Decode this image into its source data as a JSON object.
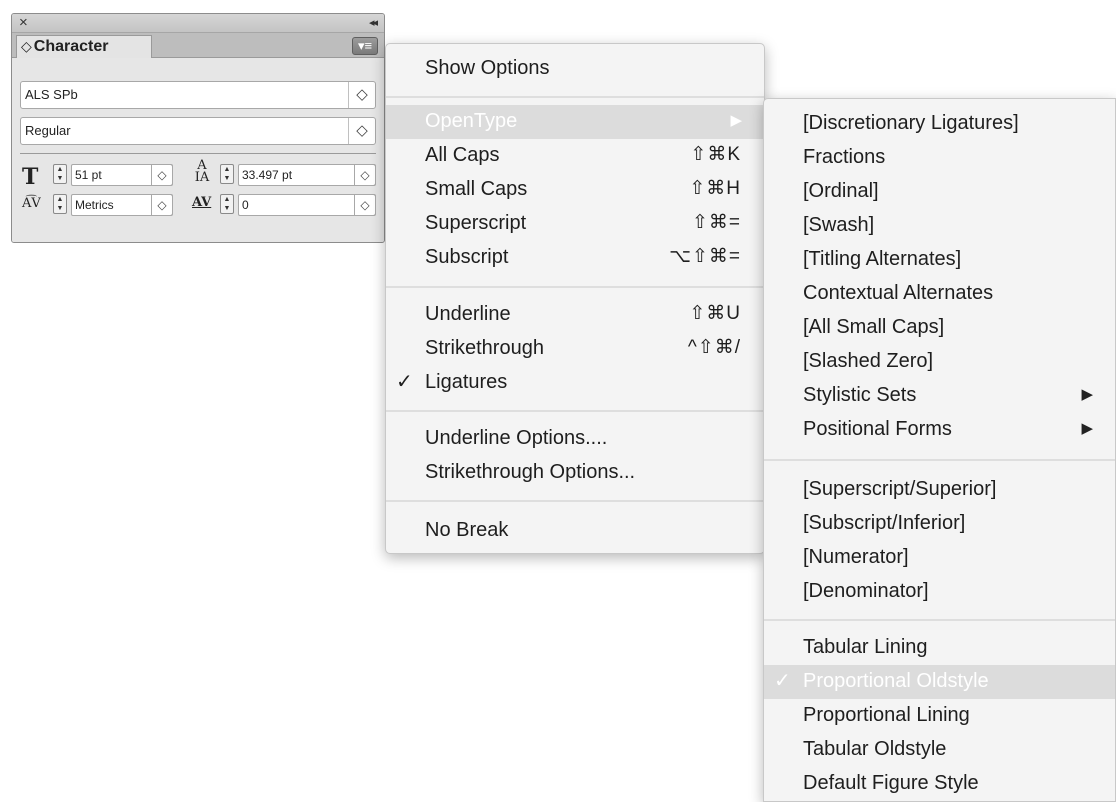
{
  "panel": {
    "close": "×",
    "collapse": "◂◂",
    "title": "Character",
    "tab_arrows": "◇",
    "menu_button": "▾≡",
    "font_family": "ALS SPb",
    "font_style": "Regular",
    "font_size": "51 pt",
    "leading": "33.497 pt",
    "kerning": "Metrics",
    "tracking": "0"
  },
  "main_menu": {
    "show_options": "Show Options",
    "opentype": "OpenType",
    "all_caps": "All Caps",
    "all_caps_sc": "⇧⌘K",
    "small_caps": "Small Caps",
    "small_caps_sc": "⇧⌘H",
    "superscript": "Superscript",
    "superscript_sc": "⇧⌘=",
    "subscript": "Subscript",
    "subscript_sc": "⌥⇧⌘=",
    "underline": "Underline",
    "underline_sc": "⇧⌘U",
    "strikethrough": "Strikethrough",
    "strikethrough_sc": "^⇧⌘/",
    "ligatures": "Ligatures",
    "underline_options": "Underline Options....",
    "strikethrough_options": "Strikethrough Options...",
    "no_break": "No Break"
  },
  "opentype_menu": {
    "discretionary_ligatures": "[Discretionary Ligatures]",
    "fractions": "Fractions",
    "ordinal": "[Ordinal]",
    "swash": "[Swash]",
    "titling_alternates": "[Titling Alternates]",
    "contextual_alternates": "Contextual Alternates",
    "all_small_caps": "[All Small Caps]",
    "slashed_zero": "[Slashed Zero]",
    "stylistic_sets": "Stylistic Sets",
    "positional_forms": "Positional Forms",
    "superscript_superior": "[Superscript/Superior]",
    "subscript_inferior": "[Subscript/Inferior]",
    "numerator": "[Numerator]",
    "denominator": "[Denominator]",
    "tabular_lining": "Tabular Lining",
    "proportional_oldstyle": "Proportional Oldstyle",
    "proportional_lining": "Proportional Lining",
    "tabular_oldstyle": "Tabular Oldstyle",
    "default_figure_style": "Default Figure Style"
  },
  "glyphs": {
    "check": "✓",
    "submenu_arrow": "▶",
    "updown": "◇"
  },
  "colors": {
    "highlight": "#dcdcdc",
    "menu_bg": "#f4f4f4",
    "panel_bg": "#e6e6e6"
  }
}
